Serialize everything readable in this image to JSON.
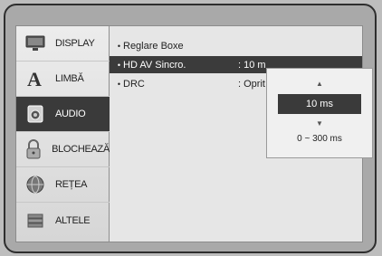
{
  "sidebar": {
    "items": [
      {
        "label": "DISPLAY",
        "icon": "display-icon"
      },
      {
        "label": "LIMBĂ",
        "icon": "language-icon"
      },
      {
        "label": "AUDIO",
        "icon": "audio-icon"
      },
      {
        "label": "BLOCHEAZĂ",
        "icon": "lock-icon"
      },
      {
        "label": "REȚEA",
        "icon": "network-icon"
      },
      {
        "label": "ALTELE",
        "icon": "others-icon"
      }
    ],
    "active_index": 2
  },
  "content": {
    "rows": [
      {
        "name": "Reglare Boxe",
        "value": ""
      },
      {
        "name": "HD AV Sincro.",
        "value": ": 10 m"
      },
      {
        "name": "DRC",
        "value": ": Oprit"
      }
    ],
    "selected_index": 1,
    "bullet": "•"
  },
  "popup": {
    "up_arrow": "▲",
    "value": "10 ms",
    "down_arrow": "▼",
    "range": "0 ~ 300 ms"
  },
  "colors": {
    "active_bg": "#3a3a3a",
    "menu_bg": "#dcdcdc"
  }
}
